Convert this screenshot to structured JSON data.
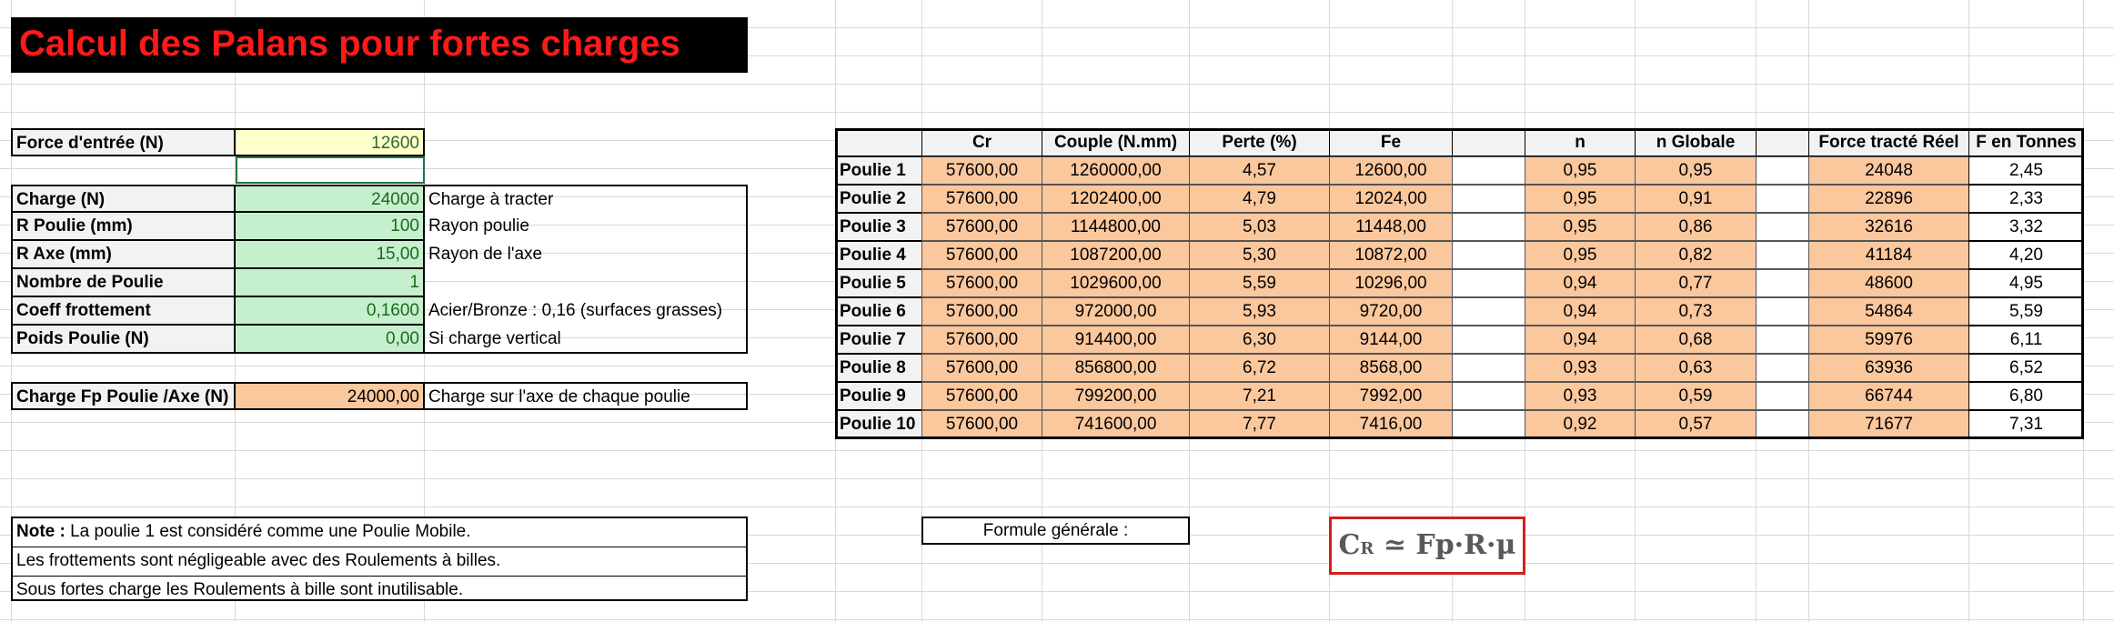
{
  "title": "Calcul des Palans pour fortes charges",
  "inputs": {
    "force_label": "Force d'entrée (N)",
    "force_value": "12600",
    "params": [
      {
        "label": "Charge (N)",
        "value": "24000",
        "desc": "Charge à tracter"
      },
      {
        "label": "R Poulie (mm)",
        "value": "100",
        "desc": "Rayon poulie"
      },
      {
        "label": "R Axe (mm)",
        "value": "15,00",
        "desc": "Rayon de l'axe"
      },
      {
        "label": "Nombre de Poulie",
        "value": "1",
        "desc": ""
      },
      {
        "label": "Coeff frottement",
        "value": "0,1600",
        "desc": "Acier/Bronze : 0,16 (surfaces grasses)"
      },
      {
        "label": "Poids Poulie (N)",
        "value": "0,00",
        "desc": "Si charge vertical"
      }
    ],
    "charge_axe": {
      "label": "Charge Fp Poulie /Axe (N)",
      "value": "24000,00",
      "desc": "Charge sur l'axe de chaque poulie"
    }
  },
  "table": {
    "headers": [
      "",
      "Cr",
      "Couple (N.mm)",
      "Perte (%)",
      "Fe",
      "",
      "n",
      "n Globale",
      "",
      "Force tracté Réel",
      "F en Tonnes"
    ],
    "rows": [
      {
        "label": "Poulie 1",
        "cr": "57600,00",
        "couple": "1260000,00",
        "perte": "4,57",
        "fe": "12600,00",
        "n": "0,95",
        "ng": "0,95",
        "force": "24048",
        "tonnes": "2,45"
      },
      {
        "label": "Poulie 2",
        "cr": "57600,00",
        "couple": "1202400,00",
        "perte": "4,79",
        "fe": "12024,00",
        "n": "0,95",
        "ng": "0,91",
        "force": "22896",
        "tonnes": "2,33"
      },
      {
        "label": "Poulie 3",
        "cr": "57600,00",
        "couple": "1144800,00",
        "perte": "5,03",
        "fe": "11448,00",
        "n": "0,95",
        "ng": "0,86",
        "force": "32616",
        "tonnes": "3,32"
      },
      {
        "label": "Poulie 4",
        "cr": "57600,00",
        "couple": "1087200,00",
        "perte": "5,30",
        "fe": "10872,00",
        "n": "0,95",
        "ng": "0,82",
        "force": "41184",
        "tonnes": "4,20"
      },
      {
        "label": "Poulie 5",
        "cr": "57600,00",
        "couple": "1029600,00",
        "perte": "5,59",
        "fe": "10296,00",
        "n": "0,94",
        "ng": "0,77",
        "force": "48600",
        "tonnes": "4,95"
      },
      {
        "label": "Poulie 6",
        "cr": "57600,00",
        "couple": "972000,00",
        "perte": "5,93",
        "fe": "9720,00",
        "n": "0,94",
        "ng": "0,73",
        "force": "54864",
        "tonnes": "5,59"
      },
      {
        "label": "Poulie 7",
        "cr": "57600,00",
        "couple": "914400,00",
        "perte": "6,30",
        "fe": "9144,00",
        "n": "0,94",
        "ng": "0,68",
        "force": "59976",
        "tonnes": "6,11"
      },
      {
        "label": "Poulie 8",
        "cr": "57600,00",
        "couple": "856800,00",
        "perte": "6,72",
        "fe": "8568,00",
        "n": "0,93",
        "ng": "0,63",
        "force": "63936",
        "tonnes": "6,52"
      },
      {
        "label": "Poulie 9",
        "cr": "57600,00",
        "couple": "799200,00",
        "perte": "7,21",
        "fe": "7992,00",
        "n": "0,93",
        "ng": "0,59",
        "force": "66744",
        "tonnes": "6,80"
      },
      {
        "label": "Poulie 10",
        "cr": "57600,00",
        "couple": "741600,00",
        "perte": "7,77",
        "fe": "7416,00",
        "n": "0,92",
        "ng": "0,57",
        "force": "71677",
        "tonnes": "7,31"
      }
    ]
  },
  "note": {
    "bold": "Note :",
    "line1": " La poulie 1 est considéré comme une Poulie Mobile.",
    "line2": "Les frottements sont négligeable avec des Roulements à billes.",
    "line3": "Sous fortes charge les Roulements à bille sont inutilisable."
  },
  "formula": {
    "label": "Formule générale :",
    "lhs": "C",
    "sub": "R",
    "rhs": " ≃ Fp·R·μ"
  },
  "colors": {
    "title_bg": "#000000",
    "title_text": "#ff1a1a",
    "input_green": "#c6efce",
    "input_yellow": "#ffffcc",
    "result_orange": "#fbc79d",
    "formula_border": "#d02020"
  }
}
